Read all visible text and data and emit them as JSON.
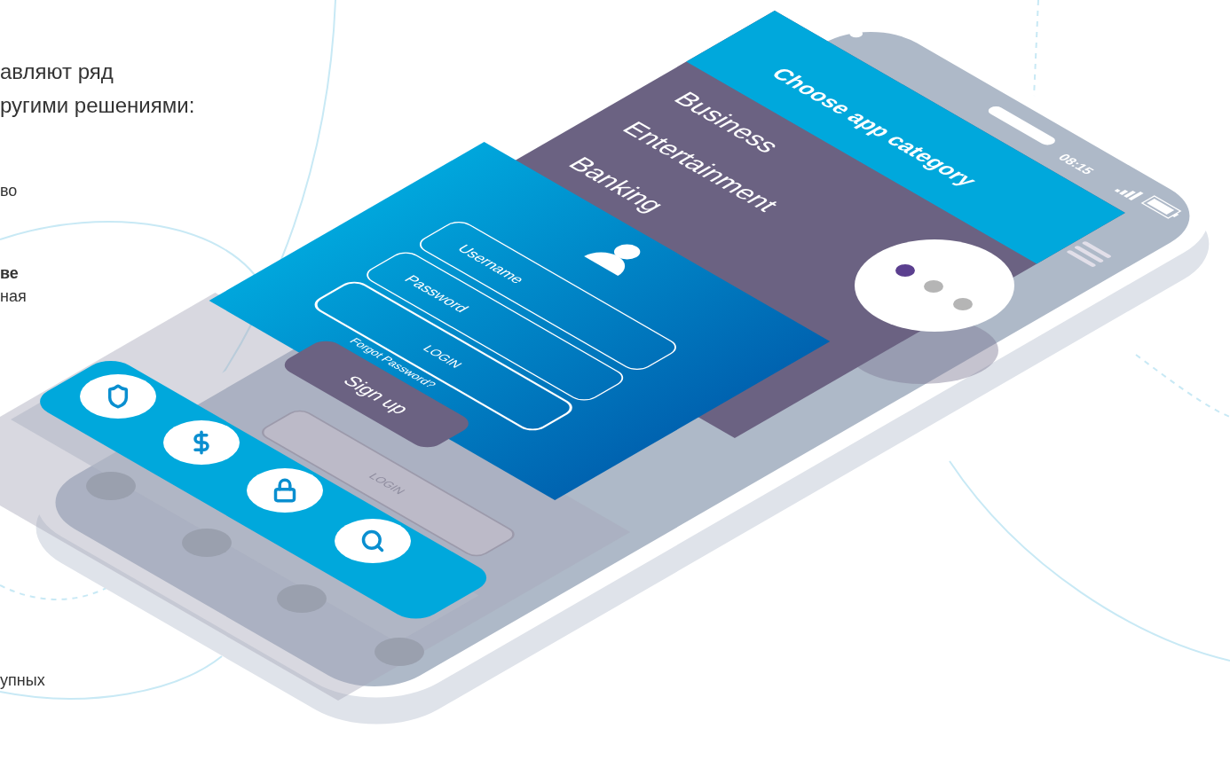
{
  "page_text": [
    {
      "text": "авляют ряд",
      "bold": false,
      "kind": "lead"
    },
    {
      "text": "ругими решениями:",
      "bold": false,
      "kind": "lead"
    },
    {
      "text": "во",
      "bold": false,
      "kind": "body"
    },
    {
      "text": "ве",
      "bold": true,
      "kind": "body"
    },
    {
      "text": "ная",
      "bold": false,
      "kind": "body"
    },
    {
      "text": "упных",
      "bold": false,
      "kind": "body"
    }
  ],
  "phone": {
    "status": {
      "time": "08:15"
    },
    "category_screen": {
      "title": "Choose app category",
      "items": [
        {
          "label": "Business"
        },
        {
          "label": "Entertainment"
        },
        {
          "label": "Banking"
        }
      ],
      "pager": [
        {
          "selected": true
        },
        {
          "selected": false
        },
        {
          "selected": false
        }
      ]
    },
    "login_screen": {
      "fields": [
        {
          "placeholder": "Username"
        },
        {
          "placeholder": "Password"
        }
      ],
      "login_button": "LOGIN",
      "forgot_link": "Forgot Password?",
      "signup_button": "Sign up"
    },
    "ghost_login_button": "LOGIN"
  }
}
